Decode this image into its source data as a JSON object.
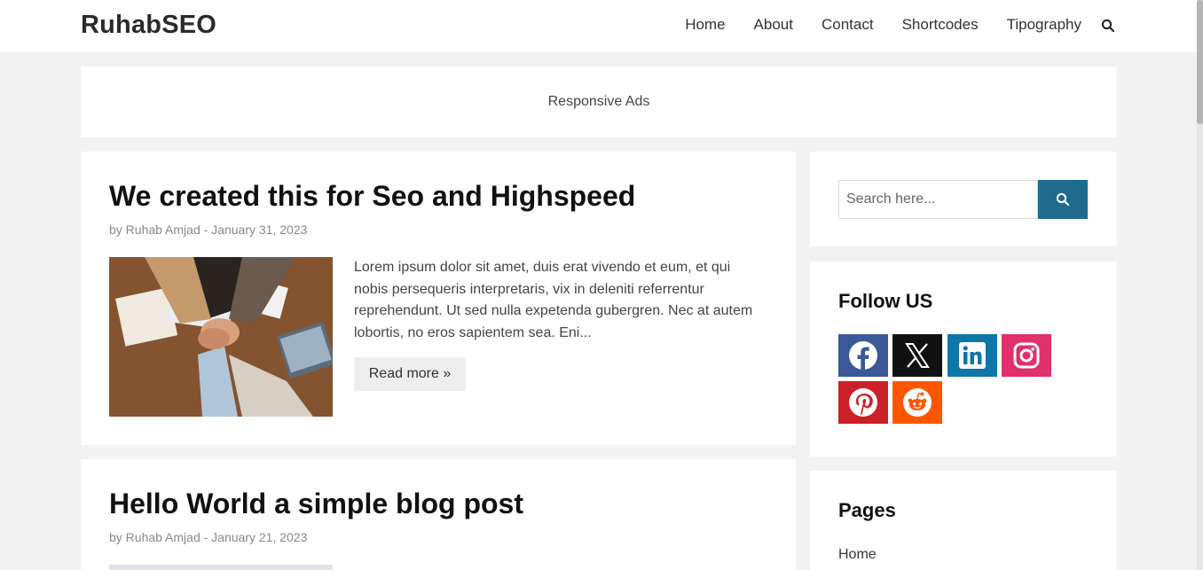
{
  "header": {
    "logo": "RuhabSEO",
    "nav": [
      "Home",
      "About",
      "Contact",
      "Shortcodes",
      "Tipography"
    ]
  },
  "ads": {
    "label": "Responsive Ads"
  },
  "posts": [
    {
      "title": "We created this for Seo and Highspeed",
      "meta": "by Ruhab Amjad - January 31, 2023",
      "excerpt": "Lorem ipsum dolor sit amet, duis erat vivendo et eum, et qui nobis persequeris interpretaris, vix in deleniti referrentur reprehendunt. Ut sed nulla expetenda gubergren. Nec at autem lobortis, no eros sapientem sea. Eni...",
      "read_more": "Read more »"
    },
    {
      "title": "Hello World a simple blog post",
      "meta": "by Ruhab Amjad - January 21, 2023"
    }
  ],
  "sidebar": {
    "search": {
      "placeholder": "Search here..."
    },
    "follow": {
      "title": "Follow US",
      "networks": [
        "facebook-icon",
        "x-icon",
        "linkedin-icon",
        "instagram-icon",
        "pinterest-icon",
        "reddit-icon"
      ]
    },
    "pages": {
      "title": "Pages",
      "items": [
        "Home"
      ]
    }
  },
  "colors": {
    "accent": "#1e6b8e",
    "facebook": "#3b5998",
    "x": "#111111",
    "linkedin": "#0e76a8",
    "instagram": "#e1306c",
    "pinterest": "#cb2027",
    "reddit": "#ff5700"
  }
}
